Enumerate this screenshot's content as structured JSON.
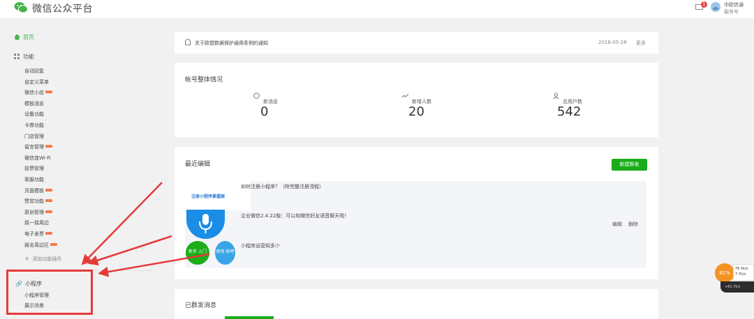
{
  "header": {
    "app_title": "微信公众平台",
    "badge_count": "1",
    "account_name": "中欧信通",
    "account_type": "服务号"
  },
  "sidebar": {
    "home": "首页",
    "functions_heading": "功能",
    "items": [
      {
        "label": "自动回复",
        "new": false
      },
      {
        "label": "自定义菜单",
        "new": false
      },
      {
        "label": "微信小店",
        "new": true
      },
      {
        "label": "模板消息",
        "new": false
      },
      {
        "label": "设备功能",
        "new": false
      },
      {
        "label": "卡券功能",
        "new": false
      },
      {
        "label": "门店管理",
        "new": false
      },
      {
        "label": "留言管理",
        "new": true
      },
      {
        "label": "微信连Wi-Fi",
        "new": false
      },
      {
        "label": "投票管理",
        "new": false
      },
      {
        "label": "客服功能",
        "new": false
      },
      {
        "label": "页面模板",
        "new": true
      },
      {
        "label": "赞赏功能",
        "new": true
      },
      {
        "label": "原创管理",
        "new": true
      },
      {
        "label": "摇一摇周边",
        "new": false
      },
      {
        "label": "电子发票",
        "new": true
      },
      {
        "label": "报名周边区",
        "new": true
      }
    ],
    "add_plugin": "添加功能插件",
    "miniprogram_heading": "小程序",
    "miniprogram_items": [
      "小程序管理",
      "展示场景"
    ]
  },
  "notice": {
    "text": "关于欧盟数据保护通用条例的通知",
    "date": "2018-05-28",
    "more": "更多"
  },
  "overview": {
    "title": "帐号整体情况",
    "stats": [
      {
        "label": "新消息",
        "value": "0",
        "icon": "message-icon"
      },
      {
        "label": "新增人数",
        "value": "20",
        "icon": "trend-icon"
      },
      {
        "label": "总用户数",
        "value": "542",
        "icon": "user-icon"
      }
    ]
  },
  "recent": {
    "title": "最近编辑",
    "new_button": "新建群发",
    "cover_text": "注册小程序掌握案",
    "green_circle_text": "新手 入门",
    "blue_circle_text": "使用 贴吧",
    "articles": [
      "如何注册小程序？（附完整注册流程）",
      "企业微信2.4.22版：可以和微信好友语音聊天啦！",
      "小程序运营知多少"
    ],
    "edit": "编辑",
    "delete": "删除"
  },
  "sent": {
    "title": "已群发消息"
  },
  "overlay": {
    "speed_percent": "82%",
    "upload": "76.5k/s",
    "download": "7.7k/s",
    "status": "+61.7k/s"
  },
  "colors": {
    "brand_green": "#1aad19",
    "annotation_red": "#e53a3a",
    "new_tag": "#f37b4b"
  }
}
